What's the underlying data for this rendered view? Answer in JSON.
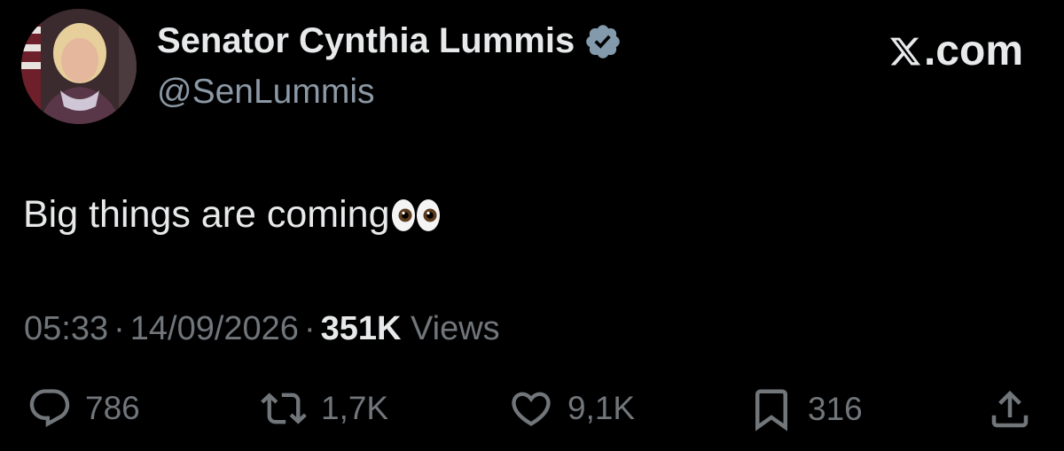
{
  "author": {
    "name": "Senator Cynthia Lummis",
    "handle": "@SenLummis",
    "verified": true
  },
  "brand": {
    "label": ".com",
    "icon": "x-logo-icon"
  },
  "tweet": {
    "text": "Big things are coming",
    "emoji": "eyes-emoji"
  },
  "meta": {
    "time": "05:33",
    "separator": "·",
    "date": "14/09/2026",
    "views_count": "351K",
    "views_label": "Views"
  },
  "actions": {
    "replies": "786",
    "reposts": "1,7K",
    "likes": "9,1K",
    "bookmarks": "316"
  },
  "colors": {
    "background": "#000000",
    "text_primary": "#e7e9ea",
    "text_secondary": "#71767b",
    "verified_badge": "#829aab"
  }
}
